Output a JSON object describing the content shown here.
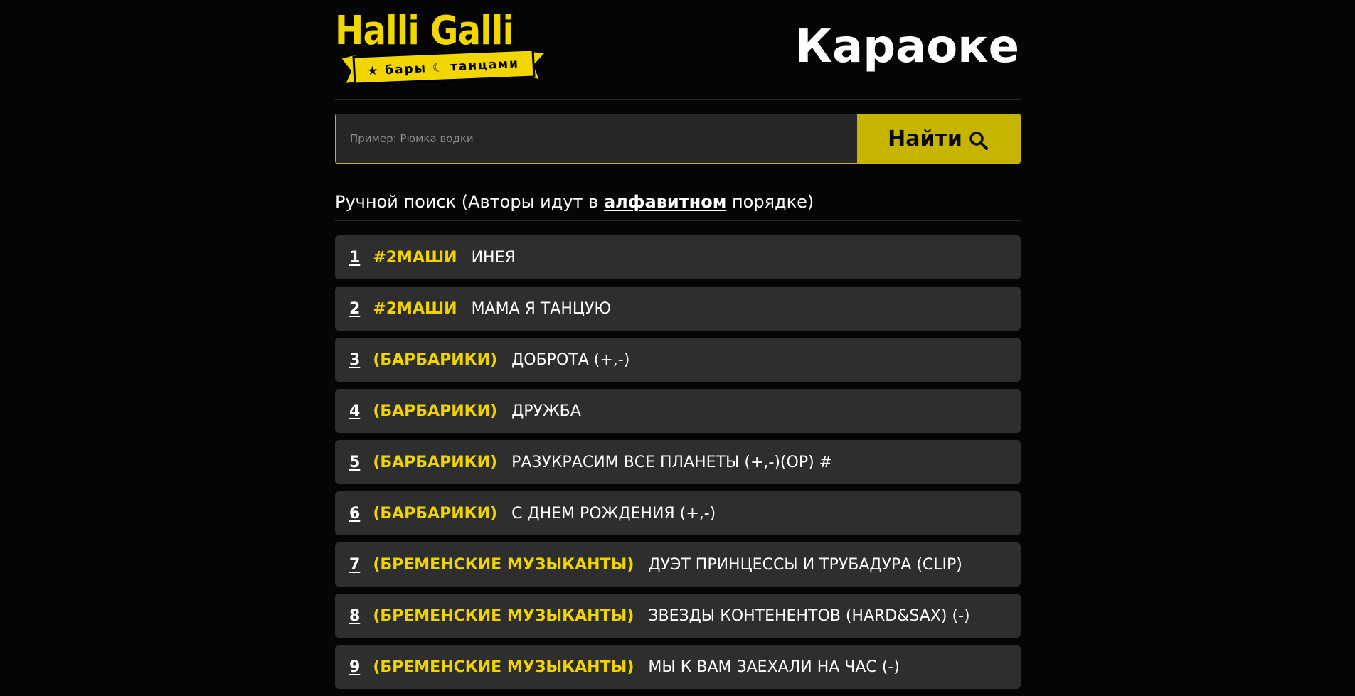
{
  "header": {
    "logo": {
      "title": "Halli Galli",
      "tagline_left": "бары",
      "tagline_right": "танцами"
    },
    "page_title": "Караоке"
  },
  "search": {
    "placeholder": "Пример: Рюмка водки",
    "value": "",
    "button_label": "Найти"
  },
  "section": {
    "prefix": "Ручной поиск (Авторы идут в ",
    "link": "алфавитном",
    "suffix": " порядке)"
  },
  "songs": [
    {
      "number": "1",
      "artist": "#2МАШИ",
      "title": "ИНЕЯ"
    },
    {
      "number": "2",
      "artist": "#2МАШИ",
      "title": "МАМА Я ТАНЦУЮ"
    },
    {
      "number": "3",
      "artist": "(БАРБАРИКИ)",
      "title": "ДОБРОТА (+,-)"
    },
    {
      "number": "4",
      "artist": "(БАРБАРИКИ)",
      "title": "ДРУЖБА"
    },
    {
      "number": "5",
      "artist": "(БАРБАРИКИ)",
      "title": "РАЗУКРАСИМ ВСЕ ПЛАНЕТЫ (+,-)(OP) #"
    },
    {
      "number": "6",
      "artist": "(БАРБАРИКИ)",
      "title": "С ДНЕМ РОЖДЕНИЯ (+,-)"
    },
    {
      "number": "7",
      "artist": "(БРЕМЕНСКИЕ МУЗЫКАНТЫ)",
      "title": "ДУЭТ ПРИНЦЕССЫ И ТРУБАДУРА (CLIP)"
    },
    {
      "number": "8",
      "artist": "(БРЕМЕНСКИЕ МУЗЫКАНТЫ)",
      "title": "ЗВЕЗДЫ КОНТЕНЕНТОВ (HARD&SAX) (-)"
    },
    {
      "number": "9",
      "artist": "(БРЕМЕНСКИЕ МУЗЫКАНТЫ)",
      "title": "МЫ К ВАМ ЗАЕХАЛИ НА ЧАС (-)"
    }
  ],
  "colors": {
    "background": "#050505",
    "accent": "#f0d400",
    "button": "#c7b400",
    "row": "#2e2e2e"
  },
  "icons": {
    "search_button": "search-icon",
    "logo_moon": "moon-icon",
    "logo_star": "star-icon"
  }
}
